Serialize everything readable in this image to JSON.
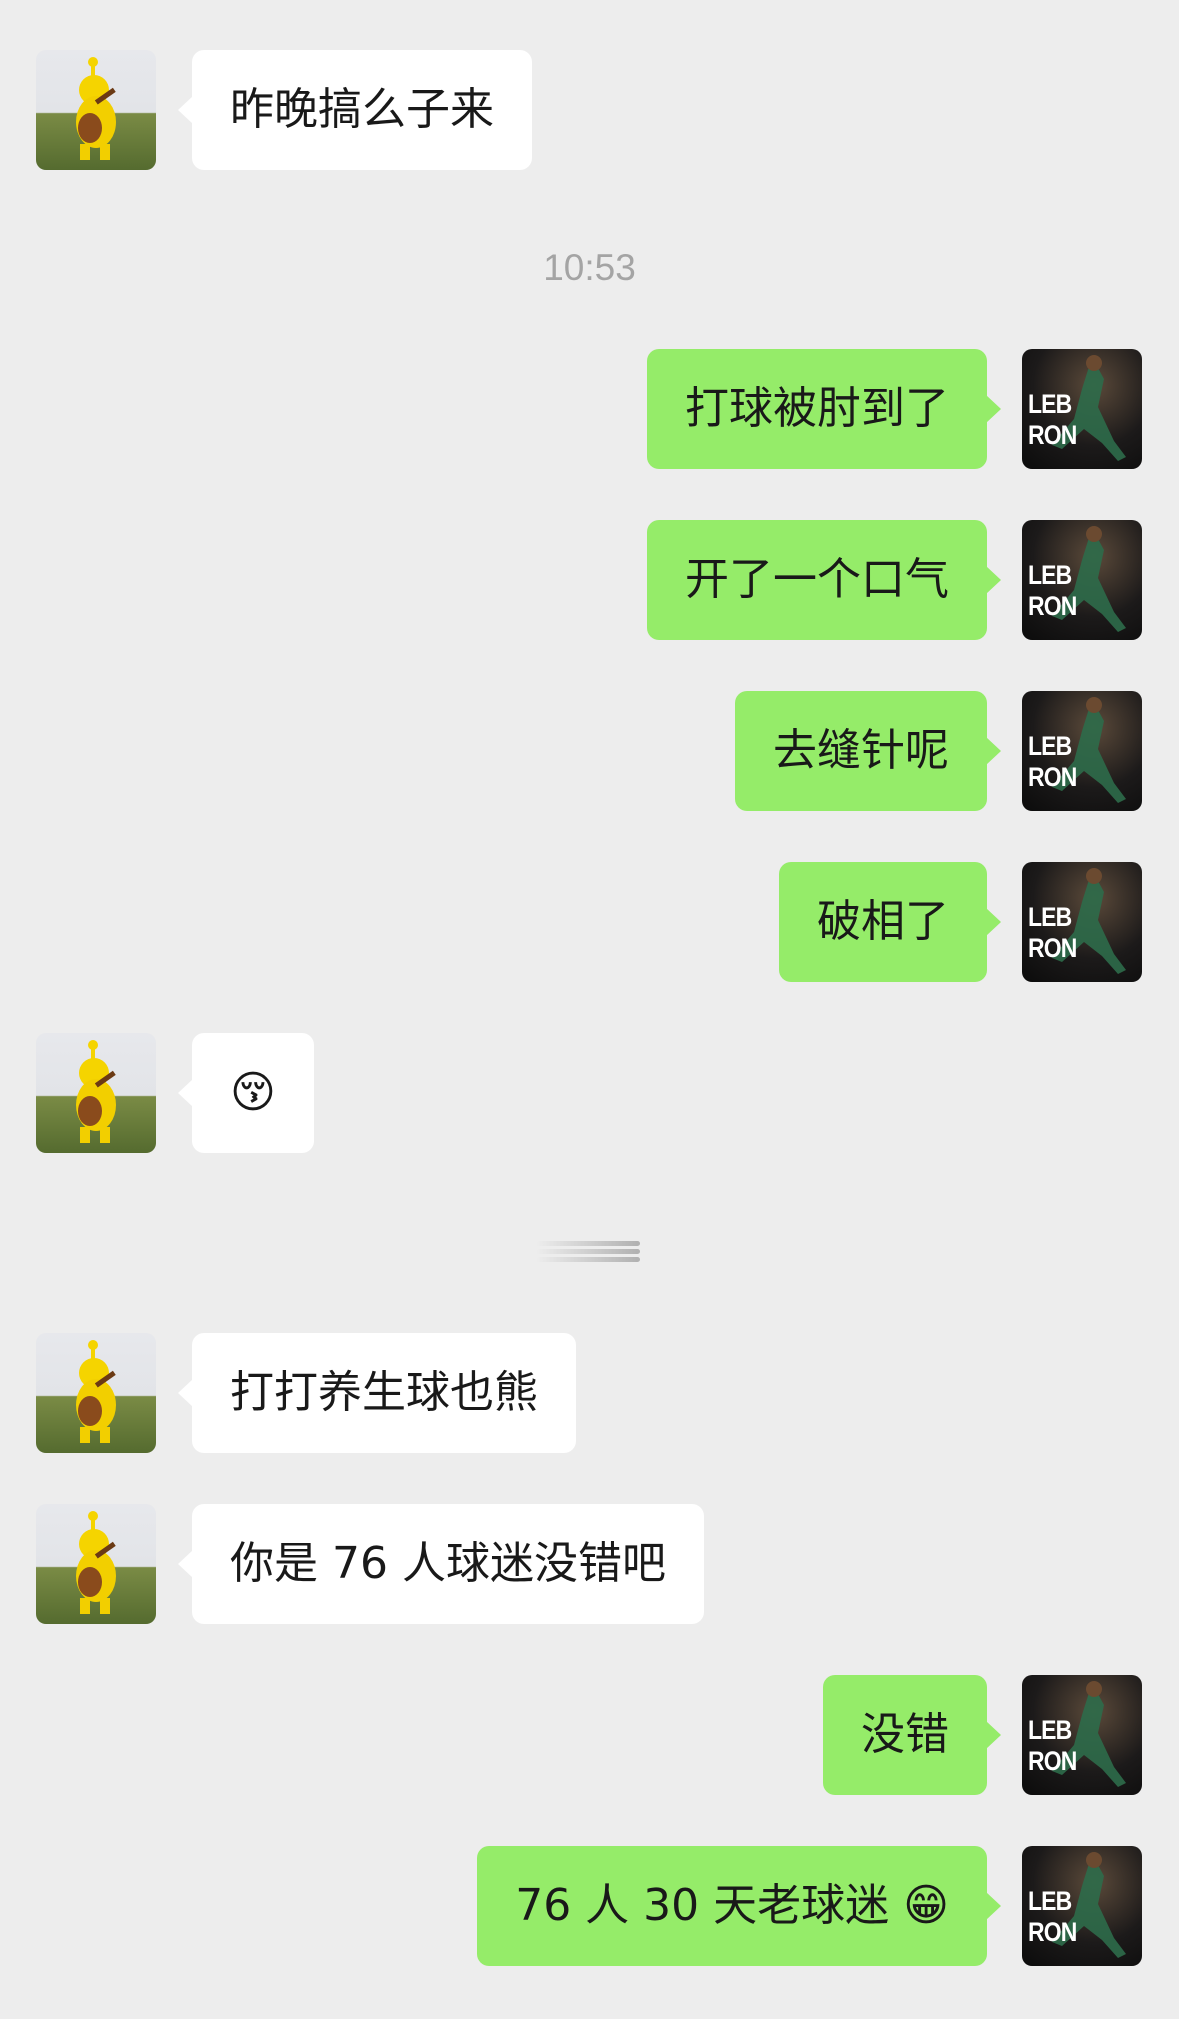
{
  "chat": {
    "timestamp": "10:53",
    "avatars": {
      "contact": "teletubby-avatar",
      "me": "lebron-avatar",
      "me_text": "LEB RON"
    },
    "messages": [
      {
        "sender": "contact",
        "text": "昨晚搞么子来"
      },
      {
        "sender": "me",
        "text": "打球被肘到了"
      },
      {
        "sender": "me",
        "text": "开了一个口气"
      },
      {
        "sender": "me",
        "text": "去缝针呢"
      },
      {
        "sender": "me",
        "text": "破相了"
      },
      {
        "sender": "contact",
        "text": "😚"
      },
      {
        "sender": "contact",
        "text": "打打养生球也熊"
      },
      {
        "sender": "contact",
        "text": "你是 76 人球迷没错吧"
      },
      {
        "sender": "me",
        "text": "没错"
      },
      {
        "sender": "me",
        "text": "76 人 30 天老球迷 😁"
      }
    ]
  },
  "colors": {
    "background": "#ededed",
    "incoming_bubble": "#ffffff",
    "outgoing_bubble": "#95ec69",
    "text": "#191919",
    "timestamp": "#a4a4a4"
  }
}
